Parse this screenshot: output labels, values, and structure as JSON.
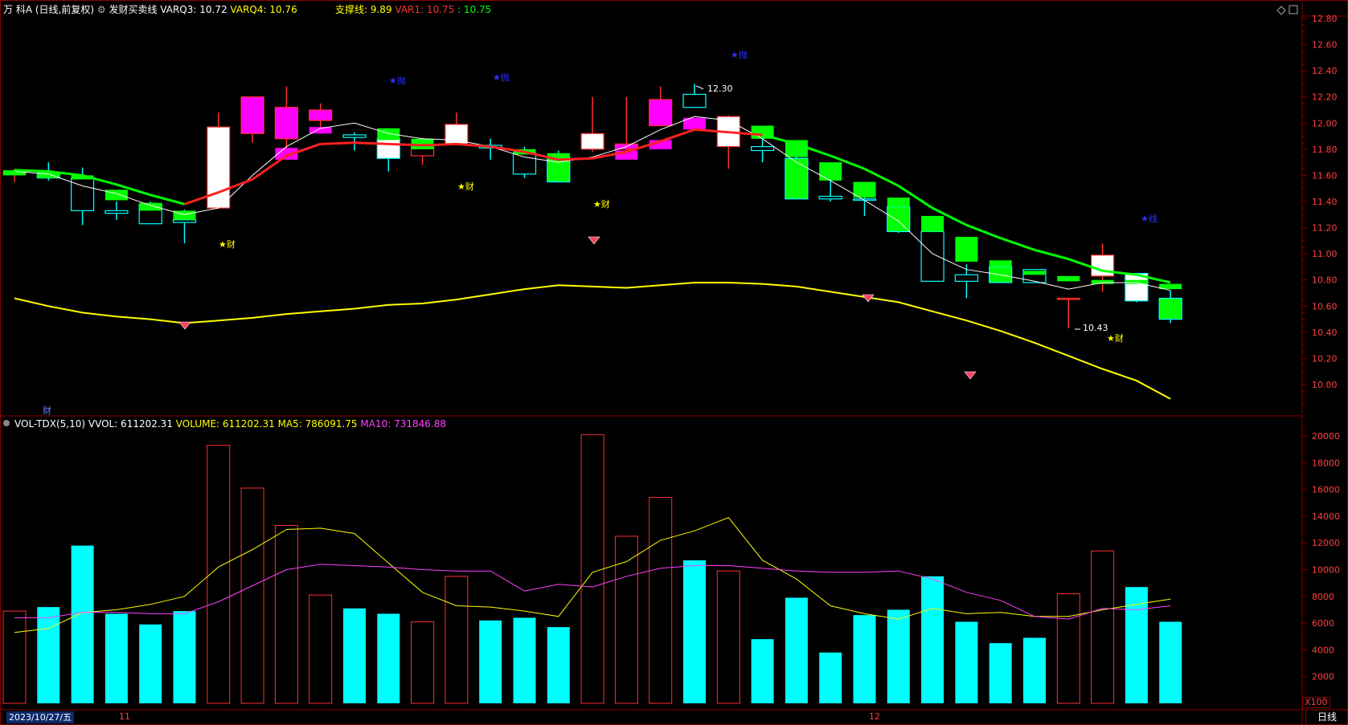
{
  "header": {
    "stock": "万 科A",
    "period": "(日线,前复权)",
    "indicator": "发财买卖线",
    "varq3": "VARQ3: 10.72",
    "varq4": "VARQ4: 10.76",
    "support": "支撑线: 9.89",
    "var1": "VAR1: 10.75",
    "var1b": ": 10.75"
  },
  "vol_header": {
    "name": "VOL-TDX(5,10)",
    "vvol": "VVOL: 611202.31",
    "volume": "VOLUME: 611202.31",
    "ma5": "MA5: 786091.75",
    "ma10": "MA10: 731846.88"
  },
  "annotations": {
    "high": "12.30",
    "low": "10.43",
    "cai": "★财",
    "cai_plain": "财",
    "sell": "★抛",
    "line": "★线"
  },
  "bottom": {
    "date": "2023/10/27/五",
    "month11": "11",
    "month12": "12",
    "period_label": "日线",
    "multiplier": "X100"
  },
  "colors": {
    "up": "#ff3030",
    "down": "#00ffff",
    "green_fill": "#00ff00",
    "magenta_fill": "#ff00ff",
    "white_fill": "#ffffff",
    "axis": "#8b0000",
    "support": "#ffff00",
    "var_red": "#ff2020",
    "var_green": "#00ff00"
  },
  "chart_data": {
    "type": "candlestick",
    "price_axis": [
      12.8,
      12.6,
      12.4,
      12.2,
      12.0,
      11.8,
      11.6,
      11.4,
      11.2,
      11.0,
      10.8,
      10.6,
      10.4,
      10.2,
      10.0
    ],
    "volume_axis": [
      20000,
      18000,
      16000,
      14000,
      12000,
      10000,
      8000,
      6000,
      4000,
      2000
    ],
    "candles": [
      {
        "o": 11.62,
        "c": 11.62,
        "h": 11.65,
        "l": 11.55
      },
      {
        "o": 11.61,
        "c": 11.58,
        "h": 11.7,
        "l": 11.56
      },
      {
        "o": 11.58,
        "c": 11.33,
        "h": 11.66,
        "l": 11.22
      },
      {
        "o": 11.33,
        "c": 11.31,
        "h": 11.4,
        "l": 11.26
      },
      {
        "o": 11.38,
        "c": 11.23,
        "h": 11.4,
        "l": 11.23
      },
      {
        "o": 11.26,
        "c": 11.24,
        "h": 11.34,
        "l": 11.08
      },
      {
        "o": 11.35,
        "c": 11.97,
        "h": 12.08,
        "l": 11.35
      },
      {
        "o": 11.92,
        "c": 12.2,
        "h": 12.2,
        "l": 11.85
      },
      {
        "o": 11.88,
        "c": 12.12,
        "h": 12.28,
        "l": 11.78
      },
      {
        "o": 12.02,
        "c": 12.1,
        "h": 12.15,
        "l": 11.95
      },
      {
        "o": 11.91,
        "c": 11.89,
        "h": 11.93,
        "l": 11.79
      },
      {
        "o": 11.88,
        "c": 11.73,
        "h": 11.96,
        "l": 11.63
      },
      {
        "o": 11.75,
        "c": 11.82,
        "h": 11.89,
        "l": 11.68
      },
      {
        "o": 11.84,
        "c": 11.99,
        "h": 12.08,
        "l": 11.84
      },
      {
        "o": 11.83,
        "c": 11.81,
        "h": 11.88,
        "l": 11.72
      },
      {
        "o": 11.77,
        "c": 11.61,
        "h": 11.82,
        "l": 11.58
      },
      {
        "o": 11.74,
        "c": 11.55,
        "h": 11.79,
        "l": 11.55
      },
      {
        "o": 11.8,
        "c": 11.92,
        "h": 12.2,
        "l": 11.78
      },
      {
        "o": 11.8,
        "c": 11.84,
        "h": 12.2,
        "l": 11.78
      },
      {
        "o": 11.98,
        "c": 12.18,
        "h": 12.28,
        "l": 11.98
      },
      {
        "o": 12.22,
        "c": 12.12,
        "h": 12.3,
        "l": 12.12
      },
      {
        "o": 11.82,
        "c": 12.05,
        "h": 12.06,
        "l": 11.65
      },
      {
        "o": 11.82,
        "c": 11.79,
        "h": 11.9,
        "l": 11.7
      },
      {
        "o": 11.73,
        "c": 11.42,
        "h": 11.77,
        "l": 11.42
      },
      {
        "o": 11.44,
        "c": 11.42,
        "h": 11.56,
        "l": 11.4
      },
      {
        "o": 11.42,
        "c": 11.41,
        "h": 11.52,
        "l": 11.29
      },
      {
        "o": 11.36,
        "c": 11.17,
        "h": 11.38,
        "l": 11.16
      },
      {
        "o": 11.17,
        "c": 10.79,
        "h": 11.19,
        "l": 10.79
      },
      {
        "o": 10.84,
        "c": 10.79,
        "h": 10.92,
        "l": 10.66
      },
      {
        "o": 10.9,
        "c": 10.78,
        "h": 10.92,
        "l": 10.78
      },
      {
        "o": 10.88,
        "c": 10.78,
        "h": 10.88,
        "l": 10.78
      },
      {
        "o": 10.66,
        "c": 10.66,
        "h": 10.66,
        "l": 10.43
      },
      {
        "o": 10.83,
        "c": 10.99,
        "h": 11.08,
        "l": 10.71
      },
      {
        "o": 10.85,
        "c": 10.64,
        "h": 10.85,
        "l": 10.63
      },
      {
        "o": 10.66,
        "c": 10.5,
        "h": 10.72,
        "l": 10.47
      }
    ],
    "body_colors": [
      "none",
      "none",
      "none",
      "none",
      "none",
      "none",
      "white",
      "magenta",
      "magenta",
      "magenta",
      "none",
      "white",
      "none",
      "white",
      "none",
      "none",
      "green",
      "white",
      "magenta",
      "magenta",
      "none",
      "white",
      "none",
      "green",
      "none",
      "none",
      "green",
      "none",
      "none",
      "green",
      "none",
      "none",
      "white",
      "white",
      "green"
    ],
    "top_blocks": [
      [
        11.64,
        11.6,
        "green"
      ],
      [
        11.63,
        11.58,
        "green"
      ],
      [
        11.6,
        11.57,
        "green"
      ],
      [
        11.49,
        11.41,
        "green"
      ],
      [
        11.39,
        11.33,
        "green"
      ],
      [
        11.33,
        11.26,
        "green"
      ],
      null,
      null,
      [
        11.81,
        11.72,
        "magenta"
      ],
      [
        11.97,
        11.92,
        "magenta"
      ],
      null,
      [
        11.96,
        11.87,
        "green"
      ],
      [
        11.88,
        11.8,
        "green"
      ],
      null,
      null,
      [
        11.8,
        11.76,
        "green"
      ],
      [
        11.77,
        11.73,
        "green"
      ],
      null,
      [
        11.79,
        11.72,
        "magenta"
      ],
      [
        11.87,
        11.8,
        "magenta"
      ],
      [
        12.04,
        11.95,
        "magenta"
      ],
      null,
      [
        11.98,
        11.88,
        "green"
      ],
      [
        11.87,
        11.74,
        "green"
      ],
      [
        11.7,
        11.56,
        "green"
      ],
      [
        11.55,
        11.43,
        "green"
      ],
      [
        11.43,
        11.36,
        "green"
      ],
      [
        11.29,
        11.17,
        "green"
      ],
      [
        11.13,
        10.94,
        "green"
      ],
      [
        10.95,
        10.9,
        "green"
      ],
      [
        10.87,
        10.85,
        "green"
      ],
      [
        10.83,
        10.79,
        "green"
      ],
      [
        10.8,
        10.8,
        "green"
      ],
      [
        10.8,
        10.79,
        "green"
      ],
      [
        10.77,
        10.73,
        "green"
      ]
    ],
    "var_line": [
      11.64,
      11.63,
      11.6,
      11.53,
      11.45,
      11.38,
      11.47,
      11.57,
      11.75,
      11.84,
      11.85,
      11.84,
      11.83,
      11.84,
      11.82,
      11.78,
      11.72,
      11.73,
      11.78,
      11.86,
      11.95,
      11.93,
      11.91,
      11.84,
      11.75,
      11.65,
      11.52,
      11.35,
      11.22,
      11.12,
      11.03,
      10.96,
      10.87,
      10.84,
      10.78
    ],
    "ma_white": [
      11.63,
      11.61,
      11.52,
      11.46,
      11.37,
      11.3,
      11.35,
      11.6,
      11.82,
      11.96,
      12.0,
      11.92,
      11.88,
      11.87,
      11.82,
      11.74,
      11.7,
      11.74,
      11.82,
      11.95,
      12.05,
      12.02,
      11.88,
      11.7,
      11.56,
      11.41,
      11.25,
      11.0,
      10.88,
      10.84,
      10.79,
      10.73,
      10.78,
      10.78,
      10.72
    ],
    "support_line": [
      10.66,
      10.6,
      10.55,
      10.52,
      10.5,
      10.47,
      10.49,
      10.51,
      10.54,
      10.56,
      10.58,
      10.61,
      10.62,
      10.65,
      10.69,
      10.73,
      10.76,
      10.75,
      10.74,
      10.76,
      10.78,
      10.78,
      10.77,
      10.75,
      10.71,
      10.67,
      10.63,
      10.56,
      10.49,
      10.41,
      10.32,
      10.22,
      10.12,
      10.03,
      9.89
    ],
    "volumes": [
      6900,
      7200,
      11800,
      6700,
      5900,
      6900,
      19300,
      16100,
      13300,
      8100,
      7100,
      6700,
      6100,
      9500,
      6200,
      6400,
      5700,
      20100,
      12500,
      15400,
      10700,
      9900,
      4800,
      7900,
      3800,
      6600,
      7000,
      9500,
      6100,
      4500,
      4900,
      8200,
      11400,
      8700,
      6100
    ],
    "vol_ma5": [
      5300,
      5600,
      6800,
      7000,
      7400,
      8000,
      10200,
      11500,
      13000,
      13100,
      12700,
      10500,
      8300,
      7300,
      7200,
      6900,
      6500,
      9800,
      10600,
      12200,
      12900,
      13900,
      10700,
      9300,
      7300,
      6700,
      6300,
      7100,
      6700,
      6800,
      6500,
      6500,
      7000,
      7400,
      7800
    ],
    "vol_ma10": [
      6400,
      6400,
      6800,
      6800,
      6700,
      6700,
      7600,
      8800,
      10000,
      10400,
      10300,
      10200,
      10000,
      9900,
      9900,
      8400,
      8900,
      8700,
      9500,
      10100,
      10300,
      10300,
      10100,
      9900,
      9800,
      9800,
      9900,
      9300,
      8300,
      7700,
      6500,
      6300,
      7100,
      7000,
      7300
    ]
  }
}
